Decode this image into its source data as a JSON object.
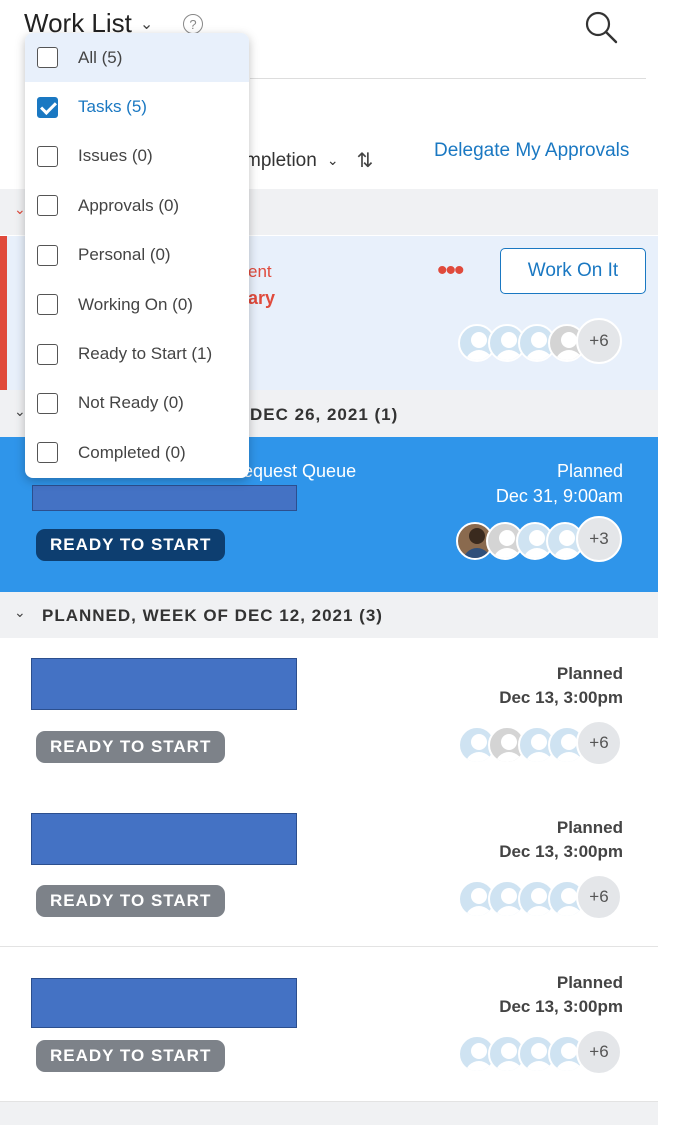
{
  "header": {
    "title": "Work List",
    "title_chevron": "⌄",
    "help_icon_text": "?",
    "search_icon": "search-icon"
  },
  "toolbar": {
    "sort_label": "mpletion",
    "sort_chevron": "⌄",
    "sort_arrows": "⇅",
    "delegate_link": "Delegate My Approvals"
  },
  "dropdown": {
    "items": [
      {
        "label": "All (5)",
        "checked": false
      },
      {
        "label": "Tasks (5)",
        "checked": true
      },
      {
        "label": "Issues (0)",
        "checked": false
      },
      {
        "label": "Approvals (0)",
        "checked": false
      },
      {
        "label": "Personal (0)",
        "checked": false
      },
      {
        "label": "Working On (0)",
        "checked": false
      },
      {
        "label": "Ready to Start (1)",
        "checked": false
      },
      {
        "label": "Not Ready (0)",
        "checked": false
      },
      {
        "label": "Completed (0)",
        "checked": false
      }
    ]
  },
  "sections": {
    "first_chevron": "⌄",
    "week_dec26": {
      "label": "DEC 26, 2021 (1)",
      "chevron": "⌄"
    },
    "week_dec12": {
      "label": "PLANNED, WEEK OF DEC 12, 2021 (3)",
      "chevron": "⌄"
    }
  },
  "card_overdue": {
    "text_line1": "ent",
    "text_line2": "ary",
    "more_dots": "•••",
    "work_button": "Work On It",
    "avatar_more": "+6"
  },
  "card_blue": {
    "queue_name": "Request Queue",
    "status_label": "Planned",
    "status_date": "Dec 31, 9:00am",
    "badge": "READY TO START",
    "avatar_more": "+3"
  },
  "cards": [
    {
      "status_label": "Planned",
      "status_date": "Dec 13, 3:00pm",
      "badge": "READY TO START",
      "avatar_more": "+6"
    },
    {
      "status_label": "Planned",
      "status_date": "Dec 13, 3:00pm",
      "badge": "READY TO START",
      "avatar_more": "+6"
    },
    {
      "status_label": "Planned",
      "status_date": "Dec 13, 3:00pm",
      "badge": "READY TO START",
      "avatar_more": "+6"
    }
  ],
  "colors": {
    "accent": "#1a78c2",
    "overdue_red": "#e04a3c",
    "selected_card": "#2f95ea",
    "redaction": "#4472c4"
  }
}
